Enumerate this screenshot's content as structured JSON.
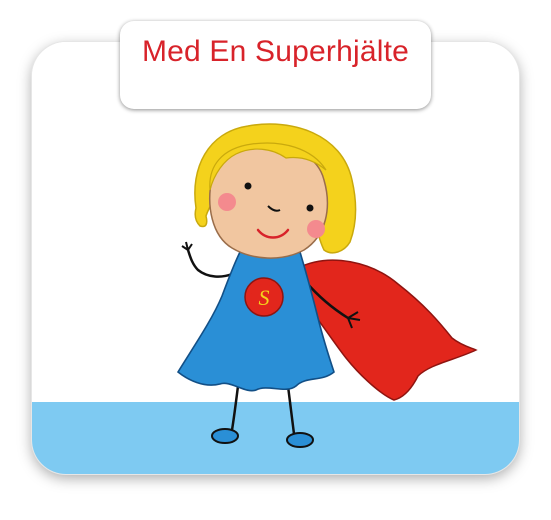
{
  "title": "Med En Superhjälte",
  "emblem_letter": "S",
  "colors": {
    "title": "#d8232a",
    "floor": "#7ecaf2",
    "dress": "#2a8fd6",
    "cape": "#e2261c",
    "hair": "#f4d21c",
    "skin": "#f1c6a0",
    "cheek": "#f48a8e",
    "emblem_ring": "#e2261c",
    "emblem_letter": "#f4d21c"
  }
}
